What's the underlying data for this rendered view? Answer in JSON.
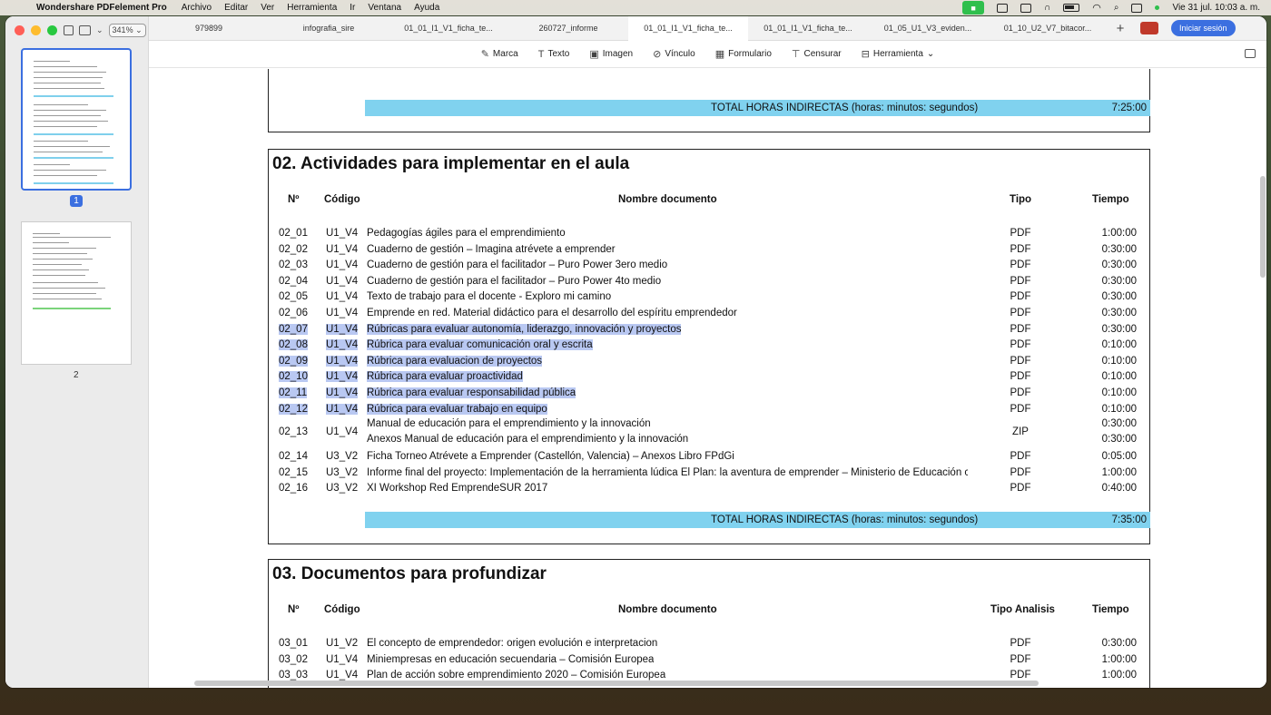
{
  "menubar": {
    "app_name": "Wondershare PDFelement Pro",
    "items": [
      "Archivo",
      "Editar",
      "Ver",
      "Herramienta",
      "Ir",
      "Ventana",
      "Ayuda"
    ],
    "clock": "Vie 31 jul.  10:03 a. m."
  },
  "sidebar": {
    "zoom": "341%",
    "pages": [
      {
        "label": "1"
      },
      {
        "label": "2"
      }
    ]
  },
  "tabs": [
    {
      "label": "979899"
    },
    {
      "label": "infografia_sire"
    },
    {
      "label": "01_01_I1_V1_ficha_te..."
    },
    {
      "label": "260727_informe"
    },
    {
      "label": "01_01_I1_V1_ficha_te..."
    },
    {
      "label": "01_01_I1_V1_ficha_te..."
    },
    {
      "label": "01_05_U1_V3_eviden..."
    },
    {
      "label": "01_10_U2_V7_bitacor..."
    }
  ],
  "tab_add": "+",
  "login_label": "Iniciar sesión",
  "toolbar": {
    "items": [
      {
        "icon": "marker-icon",
        "glyph": "✎",
        "label": "Marca"
      },
      {
        "icon": "text-icon",
        "glyph": "T",
        "label": "Texto"
      },
      {
        "icon": "image-icon",
        "glyph": "▣",
        "label": "Imagen"
      },
      {
        "icon": "link-icon",
        "glyph": "⊘",
        "label": "Vínculo"
      },
      {
        "icon": "form-icon",
        "glyph": "▦",
        "label": "Formulario"
      },
      {
        "icon": "redact-icon",
        "glyph": "⊤",
        "label": "Censurar"
      },
      {
        "icon": "tools-icon",
        "glyph": "⊟",
        "label": "Herramienta"
      }
    ]
  },
  "document": {
    "section1_total": {
      "label": "TOTAL HORAS INDIRECTAS (horas: minutos: segundos)",
      "value": "7:25:00"
    },
    "section2": {
      "title": "02. Actividades para implementar en el aula",
      "headers": {
        "num": "Nº",
        "code": "Código",
        "name": "Nombre documento",
        "type": "Tipo",
        "time": "Tiempo"
      },
      "rows": [
        {
          "num": "02_01",
          "code": "U1_V4",
          "name": "Pedagogías ágiles para el emprendimiento",
          "type": "PDF",
          "time": "1:00:00",
          "hl": false
        },
        {
          "num": "02_02",
          "code": "U1_V4",
          "name": "Cuaderno de gestión – Imagina atrévete a emprender",
          "type": "PDF",
          "time": "0:30:00",
          "hl": false
        },
        {
          "num": "02_03",
          "code": "U1_V4",
          "name": "Cuaderno de gestión para el facilitador – Puro Power 3ero medio",
          "type": "PDF",
          "time": "0:30:00",
          "hl": false
        },
        {
          "num": "02_04",
          "code": "U1_V4",
          "name": "Cuaderno de gestión para el facilitador – Puro Power 4to medio",
          "type": "PDF",
          "time": "0:30:00",
          "hl": false
        },
        {
          "num": "02_05",
          "code": "U1_V4",
          "name": "Texto de trabajo para el docente - Exploro mi camino",
          "type": "PDF",
          "time": "0:30:00",
          "hl": false
        },
        {
          "num": "02_06",
          "code": "U1_V4",
          "name": "Emprende en red. Material didáctico para el desarrollo del espíritu emprendedor",
          "type": "PDF",
          "time": "0:30:00",
          "hl": false
        },
        {
          "num": "02_07",
          "code": "U1_V4",
          "name": "Rúbricas para evaluar autonomía, liderazgo, innovación y proyectos",
          "type": "PDF",
          "time": "0:30:00",
          "hl": true
        },
        {
          "num": "02_08",
          "code": "U1_V4",
          "name": "Rúbrica para evaluar comunicación oral y escrita",
          "type": "PDF",
          "time": "0:10:00",
          "hl": true
        },
        {
          "num": "02_09",
          "code": "U1_V4",
          "name": "Rúbrica para evaluacion de proyectos",
          "type": "PDF",
          "time": "0:10:00",
          "hl": true
        },
        {
          "num": "02_10",
          "code": "U1_V4",
          "name": "Rúbrica para evaluar proactividad",
          "type": "PDF",
          "time": "0:10:00",
          "hl": true
        },
        {
          "num": "02_11",
          "code": "U1_V4",
          "name": "Rúbrica para evaluar responsabilidad pública",
          "type": "PDF",
          "time": "0:10:00",
          "hl": true
        },
        {
          "num": "02_12",
          "code": "U1_V4",
          "name": "Rúbrica para evaluar trabajo en equipo",
          "type": "PDF",
          "time": "0:10:00",
          "hl": true
        }
      ],
      "row13": {
        "num": "02_13",
        "code": "U1_V4",
        "type": "ZIP",
        "name1": "Manual de educación para el emprendimiento y la innovación",
        "time1": "0:30:00",
        "name2": "Anexos Manual de educación para el emprendimiento y la innovación",
        "time2": "0:30:00"
      },
      "rows_after": [
        {
          "num": "02_14",
          "code": "U3_V2",
          "name": "Ficha Torneo Atrévete a Emprender (Castellón, Valencia) – Anexos Libro FPdGi",
          "type": "PDF",
          "time": "0:05:00"
        },
        {
          "num": "02_15",
          "code": "U3_V2",
          "name": "Informe final del proyecto: Implementación de la herramienta lúdica El Plan: la aventura de emprender – Ministerio de Educación c",
          "type": "PDF",
          "time": "1:00:00"
        },
        {
          "num": "02_16",
          "code": "U3_V2",
          "name": "XI Workshop Red EmprendeSUR 2017",
          "type": "PDF",
          "time": "0:40:00"
        }
      ],
      "total": {
        "label": "TOTAL HORAS INDIRECTAS (horas: minutos: segundos)",
        "value": "7:35:00"
      }
    },
    "section3": {
      "title": "03. Documentos para profundizar",
      "headers": {
        "num": "Nº",
        "code": "Código",
        "name": "Nombre documento",
        "type": "Tipo Analisis",
        "time": "Tiempo"
      },
      "rows": [
        {
          "num": "03_01",
          "code": "U1_V2",
          "name": "El concepto de emprendedor: origen evolución e interpretacion",
          "type": "PDF",
          "time": "0:30:00"
        },
        {
          "num": "03_02",
          "code": "U1_V4",
          "name": "Miniempresas en educación secuendaria – Comisión Europea",
          "type": "PDF",
          "time": "1:00:00"
        },
        {
          "num": "03_03",
          "code": "U1_V4",
          "name": "Plan de acción sobre emprendimiento 2020 – Comisión Europea",
          "type": "PDF",
          "time": "1:00:00"
        }
      ]
    }
  }
}
